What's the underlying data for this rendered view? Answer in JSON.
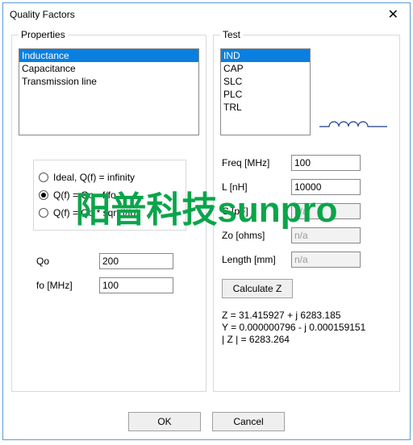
{
  "window": {
    "title": "Quality Factors"
  },
  "properties": {
    "legend": "Properties",
    "items": [
      "Inductance",
      "Capacitance",
      "Transmission line"
    ],
    "selected_index": 0,
    "radios": {
      "opt0": "Ideal, Q(f) = infinity",
      "opt1": "Q(f) = Qo · f/fo",
      "opt2": "Q(f) = Qo * sqrt(f/fo)",
      "selected_index": 1
    },
    "qo_label": "Qo",
    "qo_value": "200",
    "fo_label": "fo [MHz]",
    "fo_value": "100"
  },
  "test": {
    "legend": "Test",
    "items": [
      "IND",
      "CAP",
      "SLC",
      "PLC",
      "TRL"
    ],
    "selected_index": 0,
    "freq_label": "Freq [MHz]",
    "freq_value": "100",
    "l_label": "L [nH]",
    "l_value": "10000",
    "c_label": "C [pF]",
    "c_value": "n/a",
    "zo_label": "Zo [ohms]",
    "zo_value": "n/a",
    "len_label": "Length [mm]",
    "len_value": "n/a",
    "calc_label": "Calculate Z",
    "result_z": "Z =   31.415927 + j 6283.185",
    "result_y": "Y =   0.000000796 - j 0.000159151",
    "result_absz": "| Z | =   6283.264"
  },
  "footer": {
    "ok": "OK",
    "cancel": "Cancel"
  },
  "watermark": "阳普科技sunpro"
}
